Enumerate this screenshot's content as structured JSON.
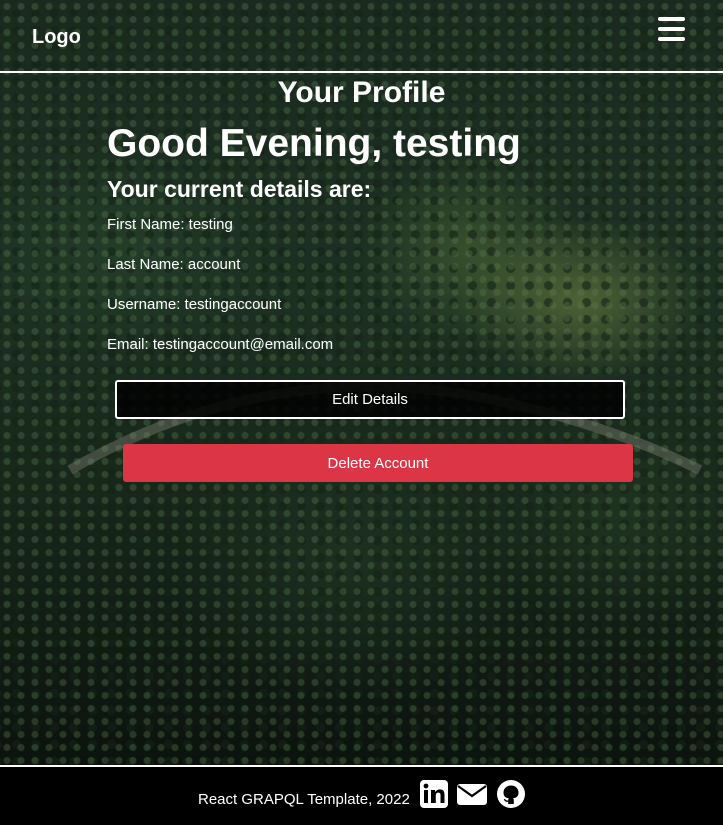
{
  "header": {
    "logo": "Logo",
    "menu_icon": "hamburger-menu-icon"
  },
  "profile": {
    "title": "Your Profile",
    "greeting": "Good Evening, testing",
    "details_heading": "Your current details are:",
    "details": [
      {
        "text": "First Name: testing"
      },
      {
        "text": "Last Name: account"
      },
      {
        "text": "Username: testingaccount"
      },
      {
        "text": "Email: testingaccount@email.com"
      }
    ],
    "edit_label": "Edit Details",
    "delete_label": "Delete Account"
  },
  "footer": {
    "text": "React GRAPQL Template, 2022",
    "icons": [
      "linkedin-icon",
      "email-icon",
      "github-icon"
    ]
  },
  "colors": {
    "danger": "#dc3545",
    "background": "#000000",
    "text": "#ffffff"
  }
}
